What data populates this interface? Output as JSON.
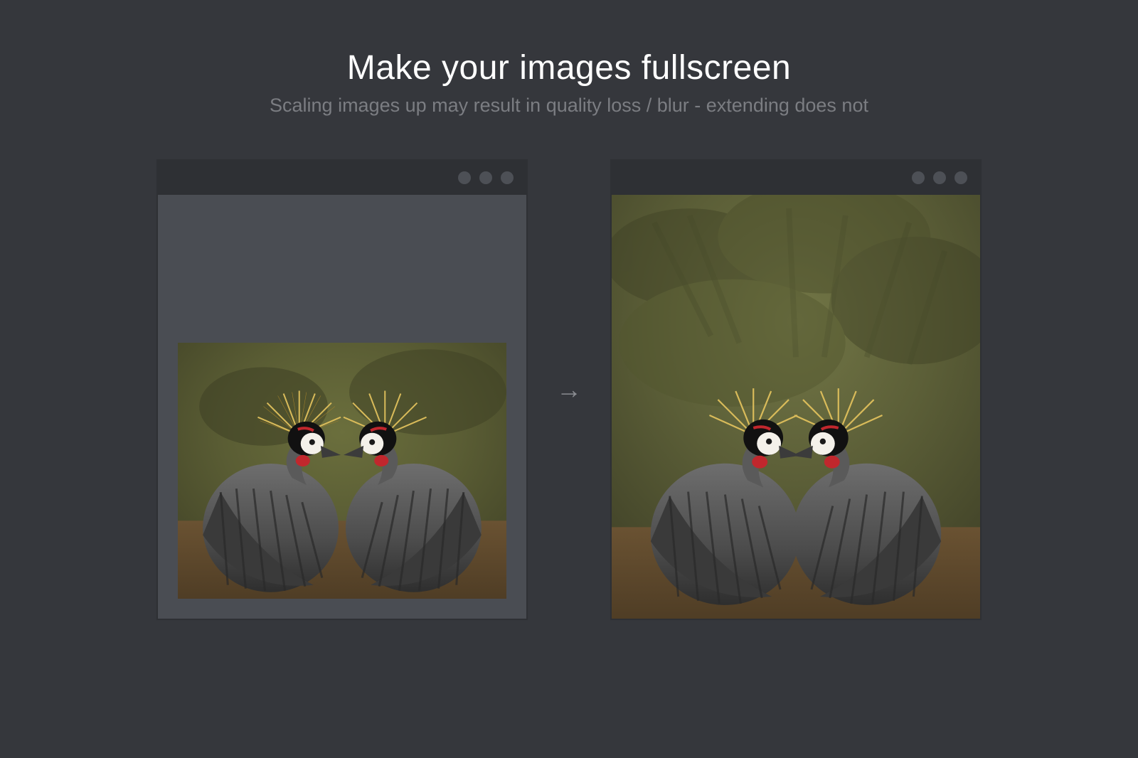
{
  "header": {
    "title": "Make your images fullscreen",
    "subtitle": "Scaling images up may result in quality loss / blur - extending does not"
  },
  "arrow_glyph": "→",
  "left_window": {
    "image_description": "crowned-crane-pair-photo",
    "mode": "letterboxed"
  },
  "right_window": {
    "image_description": "crowned-crane-pair-photo-extended-background",
    "mode": "fullscreen"
  }
}
